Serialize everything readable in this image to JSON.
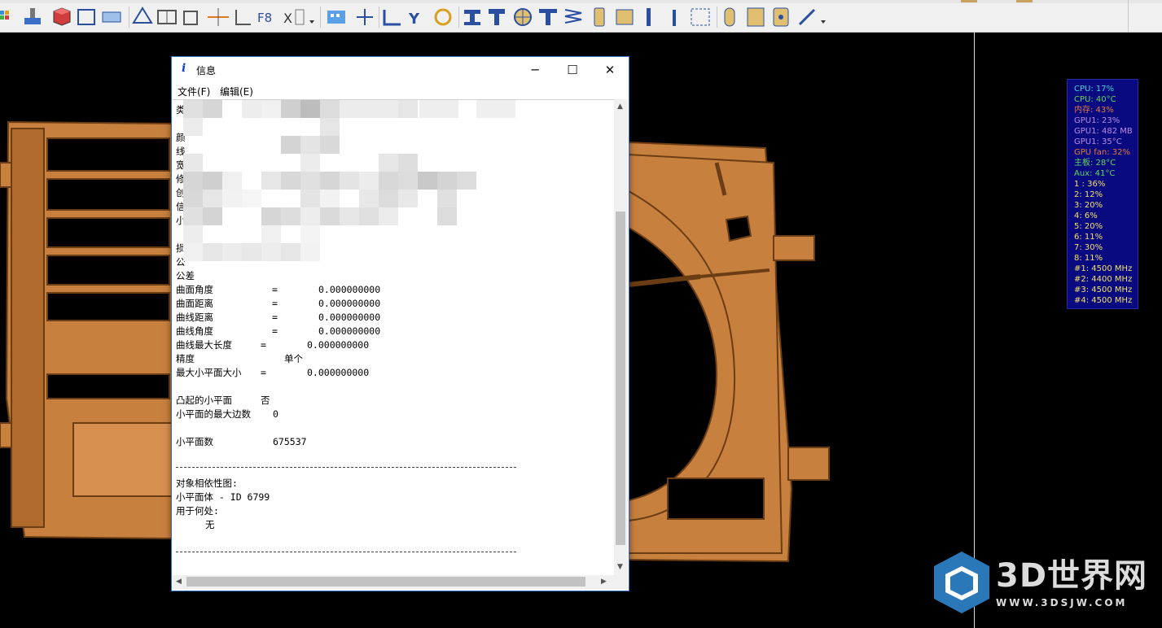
{
  "window": {
    "title": "信息",
    "title_icon": "i",
    "menus": [
      "文件(F)",
      "编辑(E)"
    ],
    "buttons": {
      "minimize": "─",
      "maximize": "☐",
      "close": "✕"
    }
  },
  "info": {
    "tolerance": {
      "header": "公差",
      "face_angle": {
        "label": "曲面角度",
        "sep": "=",
        "value": "0.000000000"
      },
      "face_distance": {
        "label": "曲面距离",
        "sep": "=",
        "value": "0.000000000"
      },
      "curve_distance": {
        "label": "曲线距离",
        "sep": "=",
        "value": "0.000000000"
      },
      "curve_angle": {
        "label": "曲线角度",
        "sep": "=",
        "value": "0.000000000"
      },
      "curve_max_length": {
        "label": "曲线最大长度",
        "sep": "=",
        "value": "0.000000000"
      },
      "precision": {
        "label": "精度",
        "value": "单个"
      },
      "max_facet_size": {
        "label": "最大小平面大小",
        "sep": "=",
        "value": "0.000000000"
      }
    },
    "convex_facet": {
      "label": "凸起的小平面",
      "value": "否"
    },
    "max_facet_edges": {
      "label": "小平面的最大边数",
      "value": "0"
    },
    "facet_count": {
      "label": "小平面数",
      "value": "675537"
    },
    "dependency": {
      "header": "对象相依性图:",
      "body": "小平面体 - ID 6799",
      "where_used": "用于何处:",
      "none": "无"
    },
    "partial_labels": [
      "类",
      "颜",
      "线",
      "宽",
      "修",
      "创",
      "信",
      "小",
      "",
      "损",
      "公"
    ]
  },
  "hardware_monitor": [
    {
      "text": "CPU: 17%",
      "color": "#45d0d0"
    },
    {
      "text": "CPU: 40°C",
      "color": "#5cd65c"
    },
    {
      "text": "内存: 43%",
      "color": "#e07a3a"
    },
    {
      "text": "GPU1: 23%",
      "color": "#b78be0"
    },
    {
      "text": "GPU1: 482 MB",
      "color": "#b78be0"
    },
    {
      "text": "GPU1: 35°C",
      "color": "#b78be0"
    },
    {
      "text": "GPU fan: 32%",
      "color": "#e07a3a"
    },
    {
      "text": "主板: 28°C",
      "color": "#5cd65c"
    },
    {
      "text": "Aux: 41°C",
      "color": "#5cd65c"
    },
    {
      "text": "1 : 36%",
      "color": "#f0e06a"
    },
    {
      "text": "2: 12%",
      "color": "#f0e06a"
    },
    {
      "text": "3: 20%",
      "color": "#f0e06a"
    },
    {
      "text": "4: 6%",
      "color": "#f0e06a"
    },
    {
      "text": "5: 20%",
      "color": "#f0e06a"
    },
    {
      "text": "6: 11%",
      "color": "#f0e06a"
    },
    {
      "text": "7: 30%",
      "color": "#f0e06a"
    },
    {
      "text": "8: 11%",
      "color": "#f0e06a"
    },
    {
      "text": "#1: 4500 MHz",
      "color": "#f0e06a"
    },
    {
      "text": "#2: 4400 MHz",
      "color": "#f0e06a"
    },
    {
      "text": "#3: 4500 MHz",
      "color": "#f0e06a"
    },
    {
      "text": "#4: 4500 MHz",
      "color": "#f0e06a"
    }
  ],
  "watermark": {
    "brand": "3D世界网",
    "url": "WWW.3DSJW.COM"
  },
  "colors": {
    "model": "#c8803e",
    "model_dark": "#6b3d14",
    "annotation_arrow": "#e02424",
    "accent": "#2b6fc7"
  },
  "toolbar_icons": [
    "grid-color-icon",
    "brush-icon",
    "cube-red-icon",
    "frame-icon",
    "block-icon",
    "shapes-icon",
    "gear-book-icon",
    "box-icon",
    "crosshair-icon",
    "axis-icon",
    "f8-icon",
    "x-grid-icon",
    "dot-grid-icon",
    "move-icon",
    "bracket-icon",
    "y-icon",
    "gear-icon",
    "beam-icon",
    "pin-icon",
    "circle-plus-icon",
    "t-beam-icon",
    "spring-icon",
    "slot-icon",
    "step-icon",
    "post-icon",
    "screw-icon",
    "dashed-box-icon",
    "rounded-post-icon",
    "panel-icon",
    "hole-icon",
    "pencil-icon"
  ]
}
